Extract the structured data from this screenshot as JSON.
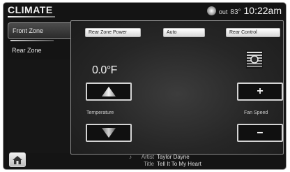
{
  "header": {
    "title": "CLIMATE",
    "outside_temp": "83°",
    "outside_label": "out",
    "time": "10:22am"
  },
  "tabs": [
    {
      "label": "Front Zone",
      "active": true
    },
    {
      "label": "Rear Zone",
      "active": false
    }
  ],
  "top_buttons": {
    "rear_zone_power": "Rear Zone Power",
    "auto": "Auto",
    "rear_control": "Rear Control"
  },
  "temperature": {
    "value": "0.0°F",
    "label": "Temperature"
  },
  "fan_speed": {
    "label": "Fan Speed",
    "plus": "+",
    "minus": "–"
  },
  "now_playing": {
    "artist_key": "Artist",
    "artist": "Taylor Dayne",
    "title_key": "Title",
    "title": "Tell It To My Heart"
  },
  "colors": {
    "screen_bg": "#141414",
    "panel_border": "#8c8c8c",
    "button_face": "#ffffff"
  },
  "icons": [
    "compass-icon",
    "up-arrow-icon",
    "down-arrow-icon",
    "fan-speed-icon",
    "home-icon",
    "music-icon"
  ]
}
